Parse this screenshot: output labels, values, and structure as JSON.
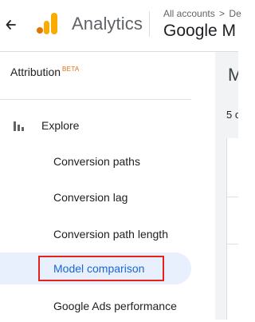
{
  "header": {
    "app_name": "Analytics",
    "breadcrumb": [
      "All accounts",
      "De"
    ],
    "breadcrumb_separator": ">",
    "property_name": "Google M",
    "back_icon": "back-arrow-icon",
    "logo_colors": [
      "#f9ab00",
      "#e37400"
    ]
  },
  "sidebar": {
    "section_title": "Attribution",
    "section_badge": "BETA",
    "explore_label": "Explore",
    "explore_icon": "bar-chart-icon",
    "items": [
      {
        "label": "Conversion paths"
      },
      {
        "label": "Conversion lag"
      },
      {
        "label": "Conversion path length"
      },
      {
        "label": "Model comparison",
        "selected": true
      },
      {
        "label": "Google Ads performance"
      }
    ]
  },
  "main": {
    "title_partial": "M",
    "subtitle_partial": "5 c"
  },
  "colors": {
    "selected_bg": "#e8f0fe",
    "selected_text": "#1967d2",
    "highlight_border": "#e2241c",
    "beta_badge": "#e8710a"
  }
}
